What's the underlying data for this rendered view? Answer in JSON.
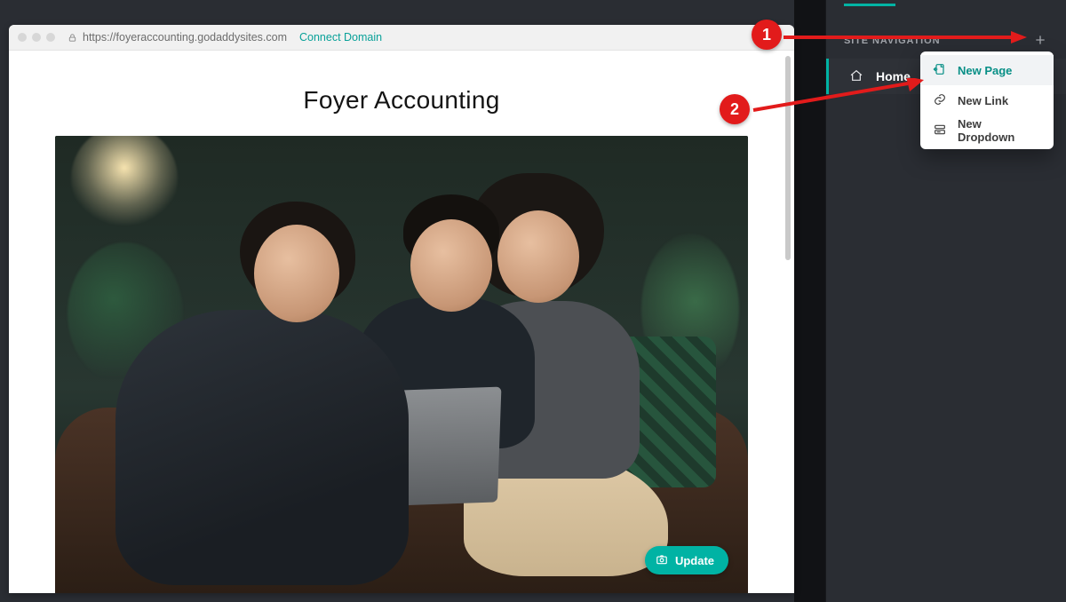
{
  "addressbar": {
    "url": "https://foyeraccounting.godaddysites.com",
    "connect_label": "Connect Domain"
  },
  "site": {
    "title": "Foyer Accounting"
  },
  "hero": {
    "update_label": "Update"
  },
  "panel": {
    "heading": "SITE NAVIGATION",
    "nav": {
      "items": [
        {
          "label": "Home"
        }
      ]
    },
    "add_menu": {
      "items": [
        {
          "label": "New Page"
        },
        {
          "label": "New Link"
        },
        {
          "label": "New Dropdown"
        }
      ]
    }
  },
  "annotations": {
    "step1": "1",
    "step2": "2"
  }
}
